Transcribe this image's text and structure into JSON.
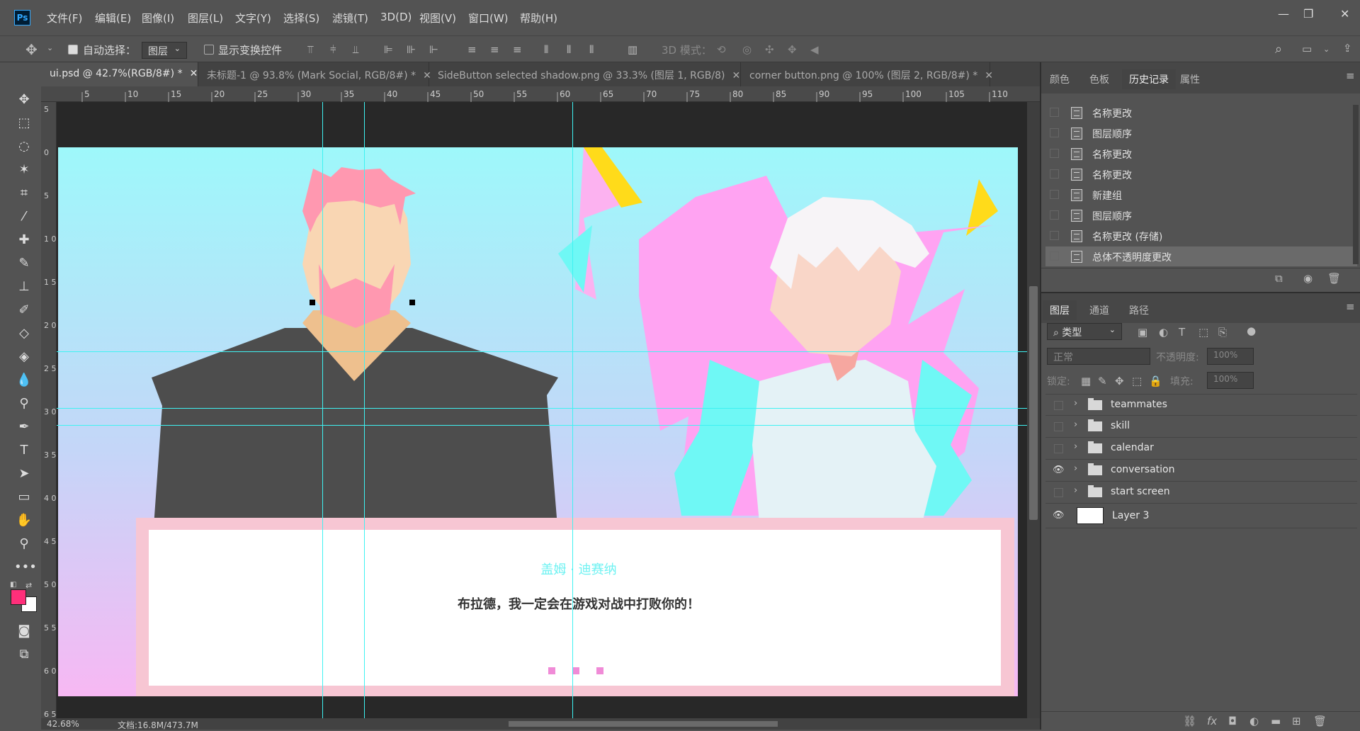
{
  "app": {
    "logo": "Ps"
  },
  "menu": [
    "文件(F)",
    "编辑(E)",
    "图像(I)",
    "图层(L)",
    "文字(Y)",
    "选择(S)",
    "滤镜(T)",
    "3D(D)",
    "视图(V)",
    "窗口(W)",
    "帮助(H)"
  ],
  "options": {
    "auto_select_label": "自动选择：",
    "auto_select_value": "图层",
    "show_transform_label": "显示变换控件",
    "mode_3d_label": "3D 模式："
  },
  "tabs": [
    {
      "label": "ui.psd @ 42.7%(RGB/8#) *",
      "active": true
    },
    {
      "label": "未标题-1 @ 93.8% (Mark Social, RGB/8#) *",
      "active": false
    },
    {
      "label": "SideButton selected shadow.png @ 33.3% (图层 1, RGB/8)",
      "active": false
    },
    {
      "label": "corner button.png @ 100% (图层 2, RGB/8#) *",
      "active": false
    }
  ],
  "ruler_h": [
    "5",
    "10",
    "15",
    "20",
    "25",
    "30",
    "35",
    "40",
    "45",
    "50",
    "55",
    "60",
    "65",
    "70",
    "75",
    "80",
    "85",
    "90",
    "95",
    "100",
    "105",
    "110"
  ],
  "ruler_v": [
    "5",
    "0",
    "5",
    "1 0",
    "1 5",
    "2 0",
    "2 5",
    "3 0",
    "3 5",
    "4 0",
    "4 5",
    "5 0",
    "5 5",
    "6 0",
    "6 5"
  ],
  "dialog": {
    "speaker": "盖姆 · 迪赛纳",
    "line": "布拉德，我一定会在游戏对战中打败你的！"
  },
  "status": {
    "zoom": "42.68%",
    "doc": "文档:16.8M/473.7M"
  },
  "history_panel": {
    "tabs": [
      "颜色",
      "色板",
      "历史记录",
      "属性"
    ],
    "active_tab": "历史记录",
    "items": [
      "名称更改",
      "图层顺序",
      "名称更改",
      "名称更改",
      "新建组",
      "图层顺序",
      "名称更改 (存储)",
      "总体不透明度更改"
    ],
    "selected_index": 7
  },
  "layers_panel": {
    "tabs": [
      "图层",
      "通道",
      "路径"
    ],
    "active_tab": "图层",
    "filter_label": "类型",
    "blend_mode": "正常",
    "opacity_label": "不透明度:",
    "opacity_value": "100%",
    "lock_label": "锁定:",
    "fill_label": "填充:",
    "fill_value": "100%",
    "layers": [
      {
        "name": "teammates",
        "type": "group",
        "visible": false
      },
      {
        "name": "skill",
        "type": "group",
        "visible": false
      },
      {
        "name": "calendar",
        "type": "group",
        "visible": false
      },
      {
        "name": "conversation",
        "type": "group",
        "visible": true
      },
      {
        "name": "start screen",
        "type": "group",
        "visible": false
      },
      {
        "name": "Layer 3",
        "type": "layer",
        "visible": true
      }
    ]
  },
  "colors": {
    "foreground": "#ff2f7a",
    "background": "#ffffff",
    "guide": "#3ff2f2"
  }
}
